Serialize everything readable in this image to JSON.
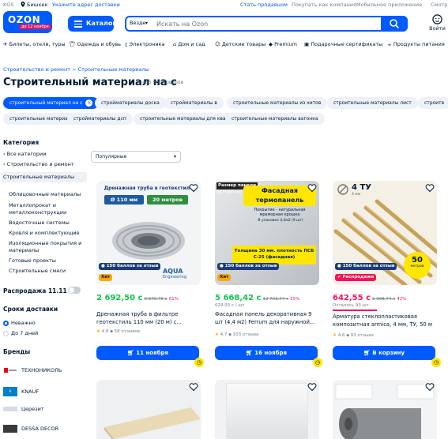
{
  "topbar": {
    "region": "KGS",
    "city": "Бишкек",
    "address_hint": "Укажите адрес доставки",
    "link_seller": "Стать продавцом",
    "link_buy_company": "Покупать как компания",
    "link_app": "Мобильное приложение",
    "link_more": "Смотр"
  },
  "header": {
    "logo_text": "OZON",
    "logo_sub": "до 12 ноября",
    "catalog_label": "Каталог",
    "search_scope": "Везде",
    "search_placeholder": "Искать на Ozon",
    "login_label": "Войти"
  },
  "nav": {
    "items": [
      {
        "label": "Билеты, отели, туры",
        "icon": "plane-icon"
      },
      {
        "label": "Одежда и обувь",
        "icon": "shirt-icon"
      },
      {
        "label": "Электроника",
        "icon": "phone-icon"
      },
      {
        "label": "Дом и сад",
        "icon": "house-icon"
      },
      {
        "label": "Детские товары",
        "icon": "toy-icon"
      },
      {
        "label": "Premium",
        "icon": "diamond-icon"
      },
      {
        "label": "Подарочные сертификаты",
        "icon": "gift-icon"
      },
      {
        "label": "Продукты питания",
        "icon": "food-icon"
      }
    ]
  },
  "breadcrumb": {
    "items": [
      "Строительство и ремонт",
      "Строительные материалы"
    ],
    "separator": ">"
  },
  "page": {
    "title": "Строительный материал на с",
    "count": "465 565 товаров"
  },
  "chips": {
    "row1": [
      "строительный материал на с",
      "стройматериалы доска",
      "стройматериалы в",
      "строительные материалы из хитов",
      "строительные материалы лист",
      "строите"
    ],
    "row2": [
      "строительные материалы на",
      "стройматериалы дсп",
      "строительные материалы для квартиры",
      "строительные материалы вагонка"
    ]
  },
  "sidebar": {
    "category_title": "Категория",
    "all_categories": "Все категории",
    "parent": "Строительство и ремонт",
    "current": "Строительные материалы",
    "subcategories": [
      "Облицовочные материалы",
      "Металлопрокат и металлоконструкции",
      "Водосточные системы",
      "Кровля и комплектующие",
      "Изоляционные покрытия и материалы",
      "Готовые проекты",
      "Строительные смеси"
    ],
    "sale_label": "Распродажа 11.11",
    "delivery_title": "Сроки доставки",
    "delivery_options": [
      "Неважно",
      "До 7 дней"
    ],
    "brands_title": "Бренды",
    "brands": [
      "ТЕХНОНИКОЛЬ",
      "KNAUF",
      "Церезит",
      "DESSA DECOR"
    ]
  },
  "sort": {
    "selected": "Популярные"
  },
  "products": [
    {
      "img_title": "Дренажная труба в геотекстиле",
      "img_tag1": "Ø 110 мм",
      "img_tag2": "20 метров",
      "img_brand": "AQUA",
      "img_brand_sub": "Engineering",
      "bonus": "150 баллов за отзыв",
      "badge": "Хит",
      "price": "2 692,50 с",
      "old_price": "6 879,75 с",
      "discount": "61%",
      "title": "Дренажная труба в фильтре геотекстиль 110 мм (20 м) с...",
      "rating": "4.8",
      "reviews": "58 отзывов",
      "button": "11 ноября"
    },
    {
      "img_title": "Фасадная термопанель",
      "img_size_label": "Размер панели",
      "img_size": "987*480 мм",
      "img_desc": "Покрытие - натуральная мраморная крошка",
      "img_pack": "В упаковке 4,4м2 (9 шт)",
      "img_thickness": "Толщина 30 мм. плотность ПСБ С-25 (фасадная)",
      "bonus": "150 баллов за отзыв",
      "badge": "Хит",
      "price": "5 668,42 с",
      "old_price": "12 703,47 с",
      "discount": "55%",
      "sub": "629,93 с / шт",
      "title": "Фасадная панель декоративная 9 шт (4,4 м2) Ferrum для наружной...",
      "rating": "4.7",
      "reviews": "103 отзыва",
      "button": "16 ноября"
    },
    {
      "img_title": "4 ТУ",
      "img_sub": "4 мм",
      "img_length": "50",
      "img_length_unit": "метров",
      "bonus": "150 баллов за отзыв",
      "badge": "Распродажа",
      "price": "642,55 с",
      "old_price": "1 098,74 с",
      "discount": "42%",
      "sub": "Осталось 93 шт",
      "title": "Арматура стеклопластиковая композитная armica, 4 мм, ТУ, 50 м",
      "rating": "4.8",
      "reviews": "93 отзыва",
      "button": "В корзину"
    }
  ],
  "colors": {
    "brand": "#005bff",
    "price_green": "#10c44c",
    "discount_pink": "#f91155",
    "hit_orange": "#ffa800",
    "bonus_navy": "#1a3c7a"
  }
}
